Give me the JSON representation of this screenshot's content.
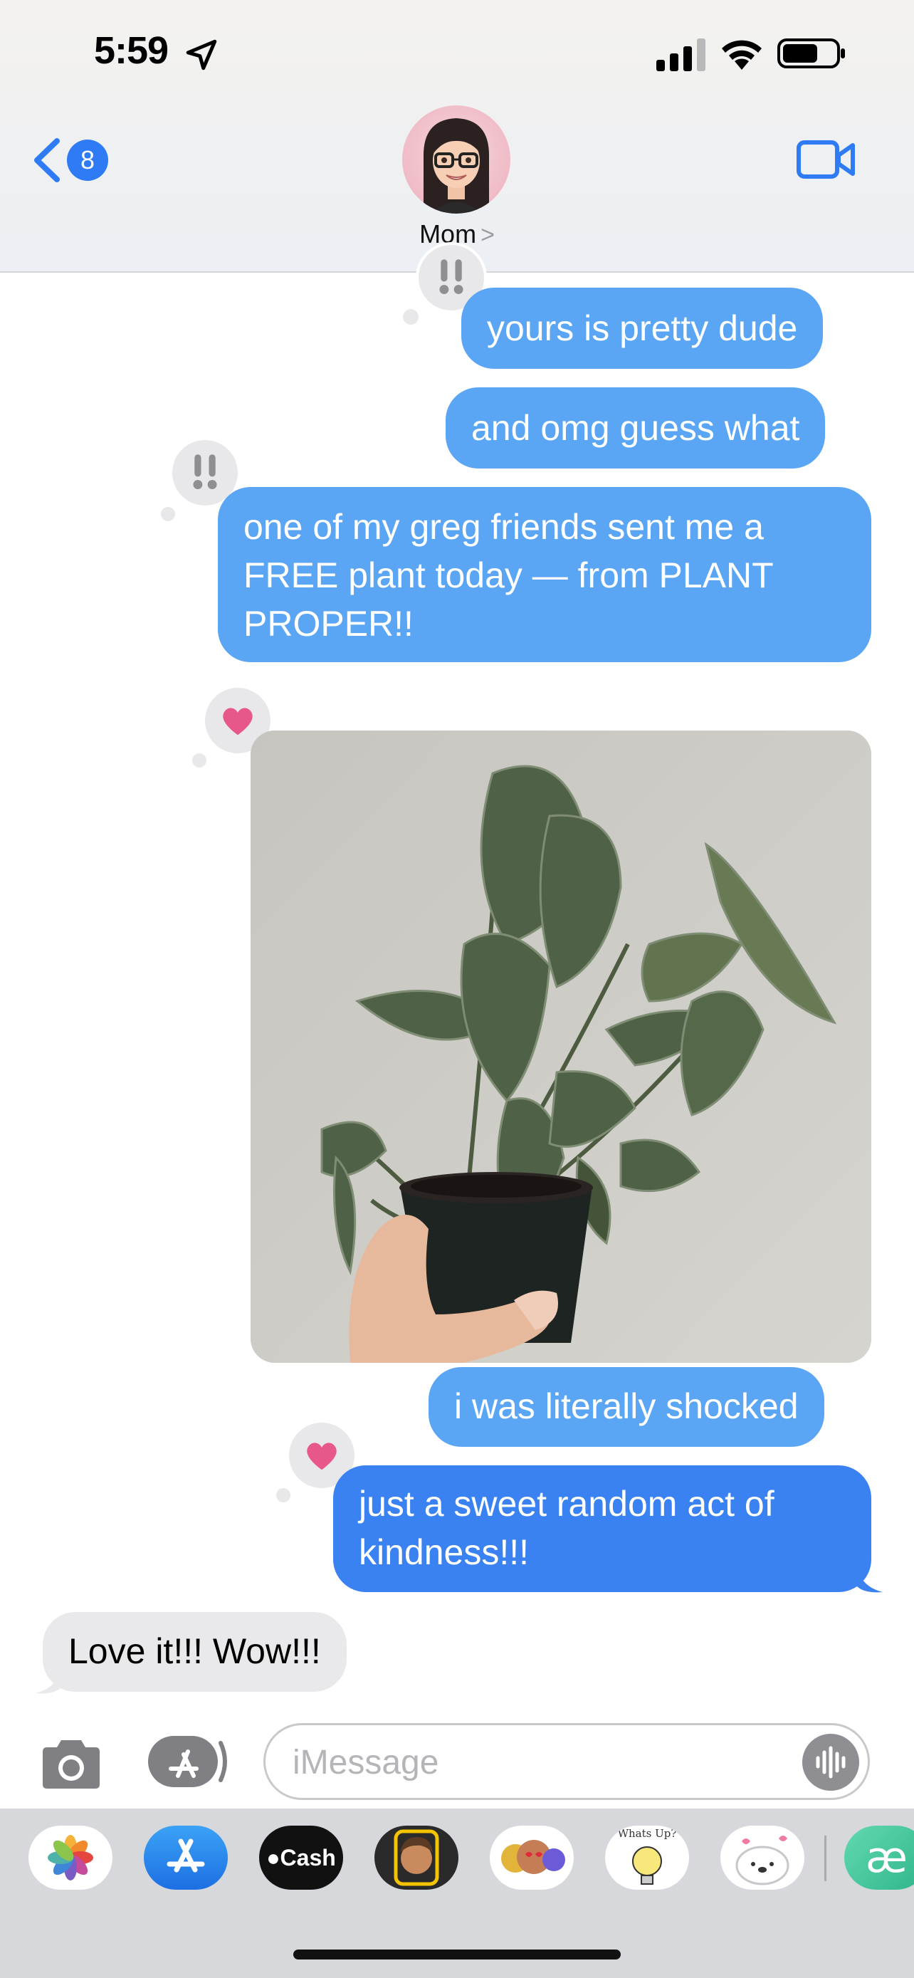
{
  "status_bar": {
    "time": "5:59"
  },
  "header": {
    "back_badge_count": "8",
    "contact_name": "Mom",
    "contact_chevron": ">"
  },
  "messages": [
    {
      "type": "sent",
      "text": "yours is pretty dude",
      "tapback": "exclamation"
    },
    {
      "type": "sent",
      "text": "and omg guess what"
    },
    {
      "type": "sent",
      "lines": [
        "one of my greg friends sent me a",
        "FREE plant today — from PLANT",
        "PROPER!!"
      ],
      "tapback": "exclamation"
    },
    {
      "type": "sent-image",
      "description": "",
      "tapback": "heart"
    },
    {
      "type": "sent",
      "text": "i was literally shocked"
    },
    {
      "type": "sent",
      "lines": [
        "just a sweet random act of",
        "kindness!!!"
      ],
      "tapback": "heart"
    },
    {
      "type": "received",
      "text": "Love it!!! Wow!!!"
    }
  ],
  "input_bar": {
    "placeholder": "iMessage"
  },
  "app_drawer": {
    "apps": [
      "photos-app-icon",
      "app-store-icon",
      "apple-cash-icon",
      "memoji-icon",
      "animoji-stickers-icon",
      "whats-up-sticker-icon",
      "seal-sticker-icon",
      "ae-app-icon"
    ],
    "cash_label": "Cash",
    "ae_label": "æ",
    "whats_up_label": "Whats Up?"
  },
  "colors": {
    "sent_bubble": "#5aa6f4",
    "sent_bubble_dark": "#3a82f2",
    "received_bubble": "#e9e9eb",
    "accent": "#2f7bf6",
    "heart": "#e8578a"
  }
}
